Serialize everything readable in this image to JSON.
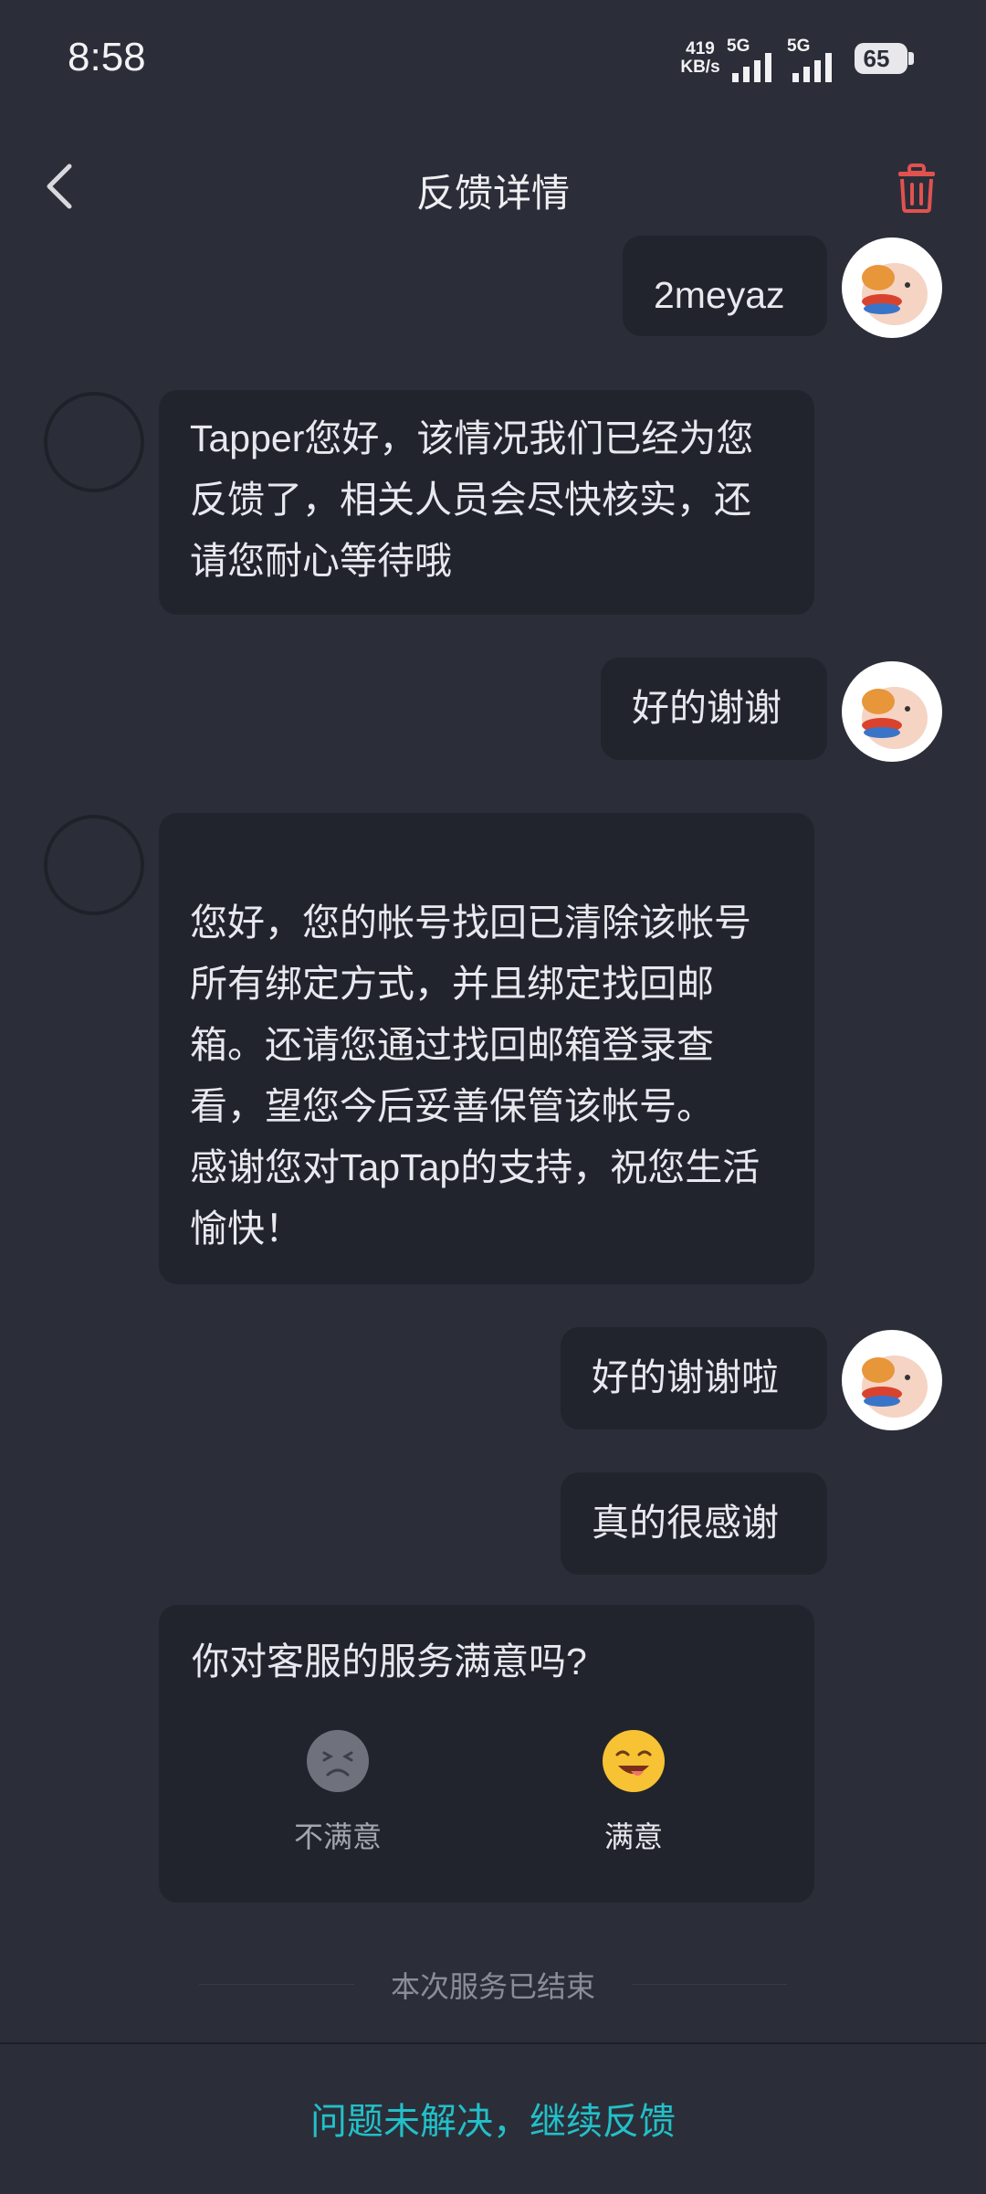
{
  "status_bar": {
    "time": "8:58",
    "net_speed_value": "419",
    "net_speed_unit": "KB/s",
    "sim1_label": "5G",
    "sim2_label": "5G",
    "battery": "65"
  },
  "header": {
    "title": "反馈详情",
    "back_icon": "chevron-left-icon",
    "delete_icon": "trash-icon"
  },
  "messages": [
    {
      "sender": "user",
      "text": "2meyaz"
    },
    {
      "sender": "support",
      "text": "Tapper您好，该情况我们已经为您反馈了，相关人员会尽快核实，还请您耐心等待哦"
    },
    {
      "sender": "user",
      "text": "好的谢谢"
    },
    {
      "sender": "support",
      "text": "您好，您的帐号找回已清除该帐号所有绑定方式，并且绑定找回邮箱。还请您通过找回邮箱登录查看，望您今后妥善保管该帐号。\n感谢您对TapTap的支持，祝您生活愉快！"
    },
    {
      "sender": "user",
      "text": "好的谢谢啦"
    },
    {
      "sender": "user",
      "text": "真的很感谢"
    }
  ],
  "survey": {
    "question": "你对客服的服务满意吗?",
    "options": [
      {
        "label": "不满意",
        "icon": "unhappy-face-icon"
      },
      {
        "label": "满意",
        "icon": "happy-face-icon"
      }
    ]
  },
  "service_ended": "本次服务已结束",
  "footer": {
    "continue_link": "问题未解决，继续反馈"
  },
  "colors": {
    "background": "#2b2e39",
    "bubble": "#22242d",
    "accent": "#22c0c8",
    "delete": "#e0524f"
  }
}
